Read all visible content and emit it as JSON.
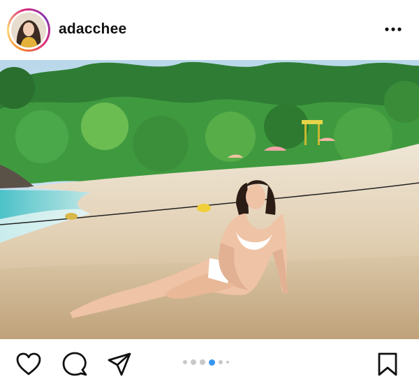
{
  "header": {
    "username": "adacchee",
    "avatar_icon": "profile-avatar",
    "more_icon": "more-horizontal-icon"
  },
  "photo": {
    "alt_subject": "beach-photo"
  },
  "actions": {
    "like_icon": "heart-icon",
    "comment_icon": "comment-icon",
    "share_icon": "paper-plane-icon",
    "save_icon": "bookmark-icon"
  },
  "carousel": {
    "total": 6,
    "active": 4
  },
  "colors": {
    "accent_blue": "#3897f0",
    "dot_inactive": "#c8c8c8",
    "text": "#111111"
  }
}
